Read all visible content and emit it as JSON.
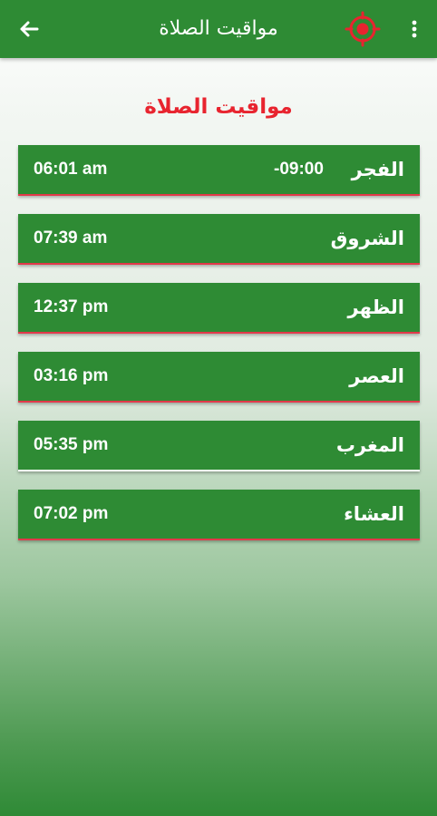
{
  "appbar": {
    "title": "مواقيت الصلاة",
    "back_icon": "arrow-left-icon",
    "location_icon": "crosshair-target-icon",
    "more_icon": "more-vertical-icon",
    "location_icon_color": "#e8242f",
    "bar_color": "#2e8b34"
  },
  "heading": "مواقيت الصلاة",
  "colors": {
    "heading": "#e8242f",
    "row_background": "#2e8b34",
    "row_underline": "#e2394a",
    "active_underline": "#ffffff"
  },
  "prayers": [
    {
      "name": "الفجر",
      "time": "06:01 am",
      "countdown": "-09:00"
    },
    {
      "name": "الشروق",
      "time": "07:39 am"
    },
    {
      "name": "الظهر",
      "time": "12:37 pm"
    },
    {
      "name": "العصر",
      "time": "03:16 pm"
    },
    {
      "name": "المغرب",
      "time": "05:35 pm",
      "active": true
    },
    {
      "name": "العشاء",
      "time": "07:02 pm"
    }
  ]
}
